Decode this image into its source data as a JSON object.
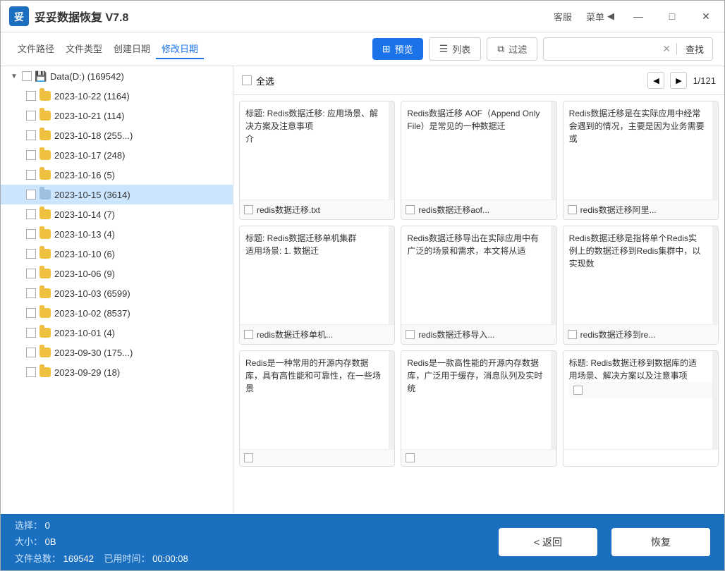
{
  "titlebar": {
    "logo_text": "妥妥数据恢复 V7.8",
    "customer_service": "客服",
    "menu": "菜单",
    "menu_icon": "◀",
    "btn_min": "—",
    "btn_max": "□",
    "btn_close": "✕"
  },
  "toolbar": {
    "nav_items": [
      {
        "label": "文件路径",
        "active": false
      },
      {
        "label": "文件类型",
        "active": false
      },
      {
        "label": "创建日期",
        "active": false
      },
      {
        "label": "修改日期",
        "active": true
      }
    ],
    "btn_preview": "预览",
    "btn_list": "列表",
    "btn_filter": "过滤",
    "search_placeholder": "",
    "search_clear": "✕",
    "search_btn": "查找"
  },
  "sidebar": {
    "root": {
      "label": "Data(D:) (169542)",
      "expanded": true
    },
    "items": [
      {
        "label": "2023-10-22 (1164)",
        "selected": false
      },
      {
        "label": "2023-10-21 (114)",
        "selected": false
      },
      {
        "label": "2023-10-18 (255...)",
        "selected": false
      },
      {
        "label": "2023-10-17 (248)",
        "selected": false
      },
      {
        "label": "2023-10-16 (5)",
        "selected": false
      },
      {
        "label": "2023-10-15 (3614)",
        "selected": true
      },
      {
        "label": "2023-10-14 (7)",
        "selected": false
      },
      {
        "label": "2023-10-13 (4)",
        "selected": false
      },
      {
        "label": "2023-10-10 (6)",
        "selected": false
      },
      {
        "label": "2023-10-06 (9)",
        "selected": false
      },
      {
        "label": "2023-10-03 (6599)",
        "selected": false
      },
      {
        "label": "2023-10-02 (8537)",
        "selected": false
      },
      {
        "label": "2023-10-01 (4)",
        "selected": false
      },
      {
        "label": "2023-09-30 (175...)",
        "selected": false
      },
      {
        "label": "2023-09-29 (18)",
        "selected": false
      }
    ]
  },
  "pagination": {
    "select_all": "全选",
    "prev": "◀",
    "next": "▶",
    "page_info": "1/121"
  },
  "file_cards": [
    {
      "preview": "<p>标题: Redis数据迁移: 应用场景、解决方案及注意事项</p><p>介",
      "filename": "redis数据迁移.txt"
    },
    {
      "preview": "<p>Redis数据迁移 AOF（Append Only File）是常见的一种数据迁",
      "filename": "redis数据迁移aof..."
    },
    {
      "preview": "<p>Redis数据迁移是在实际应用中经常会遇到的情况，主要是因为业务需要或",
      "filename": "redis数据迁移阿里..."
    },
    {
      "preview": "<p>标题: Redis数据迁移单机集群</p><p>适用场景: 1. 数据迁",
      "filename": "redis数据迁移单机..."
    },
    {
      "preview": "<p>Redis数据迁移导出在实际应用中有广泛的场景和需求，本文将从适",
      "filename": "redis数据迁移导入..."
    },
    {
      "preview": "<p>Redis数据迁移是指将单个Redis实例上的数据迁移到Redis集群中，以实现数",
      "filename": "redis数据迁移到re..."
    },
    {
      "preview": "<p>Redis是一种常用的开源内存数据库，具有高性能和可靠性，在一些场景",
      "filename": ""
    },
    {
      "preview": "<p>Redis是一款高性能的开源内存数据库，广泛用于缓存，消息队列及实时统",
      "filename": ""
    },
    {
      "preview": "<p>标题: Redis数据迁移到数据库的适用场景、解决方案以及注意事项</",
      "filename": ""
    }
  ],
  "statusbar": {
    "select_label": "选择：",
    "select_value": "0",
    "size_label": "大小：",
    "size_value": "0B",
    "total_label": "文件总数：",
    "total_value": "169542",
    "time_label": "已用时间：",
    "time_value": "00:00:08",
    "btn_back": "< 返回",
    "btn_restore": "恢复"
  }
}
